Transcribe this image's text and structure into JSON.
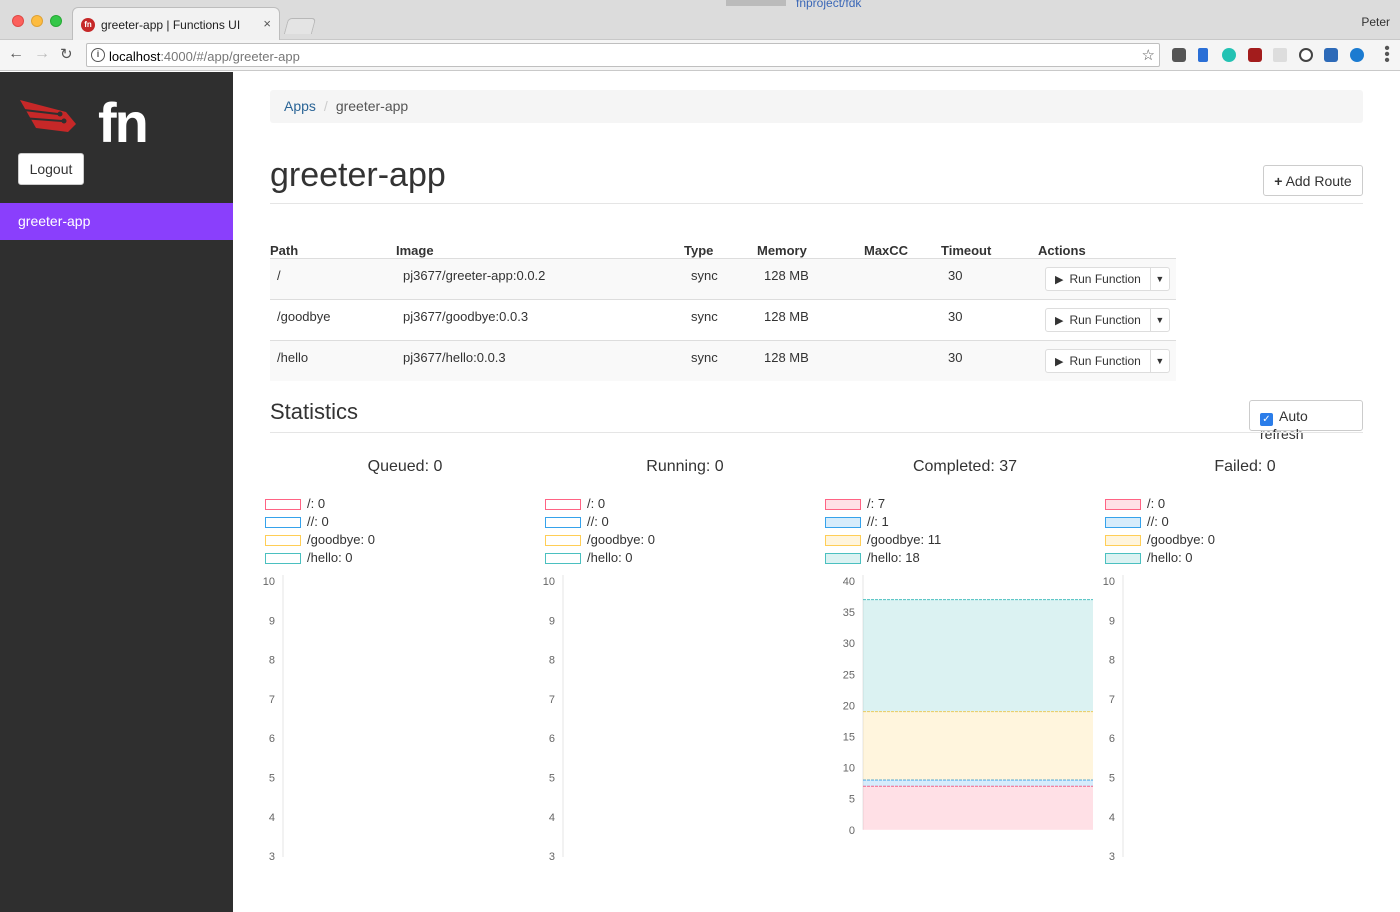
{
  "browser": {
    "tab_title": "greeter-app | Functions UI",
    "tab_close": "×",
    "profile": "Peter",
    "background_link": "fnproject/fdk",
    "url_host": "localhost",
    "url_path": ":4000/#/app/greeter-app",
    "favicon_text": "fn"
  },
  "sidebar": {
    "logo_text": "fn",
    "logout_label": "Logout",
    "items": [
      {
        "label": "greeter-app"
      }
    ]
  },
  "breadcrumb": {
    "root": "Apps",
    "current": "greeter-app"
  },
  "page": {
    "title": "greeter-app",
    "add_route_label": "Add Route"
  },
  "routes": {
    "headers": [
      "Path",
      "Image",
      "Type",
      "Memory",
      "MaxCC",
      "Timeout",
      "Actions"
    ],
    "rows": [
      {
        "path": "/",
        "image": "pj3677/greeter-app:0.0.2",
        "type": "sync",
        "memory": "128 MB",
        "maxcc": "",
        "timeout": "30",
        "action": "Run Function"
      },
      {
        "path": "/goodbye",
        "image": "pj3677/goodbye:0.0.3",
        "type": "sync",
        "memory": "128 MB",
        "maxcc": "",
        "timeout": "30",
        "action": "Run Function"
      },
      {
        "path": "/hello",
        "image": "pj3677/hello:0.0.3",
        "type": "sync",
        "memory": "128 MB",
        "maxcc": "",
        "timeout": "30",
        "action": "Run Function"
      }
    ]
  },
  "statistics": {
    "title": "Statistics",
    "auto_refresh_label": "Auto refresh",
    "auto_refresh_checked": true
  },
  "series_colors": {
    "/": "#ff6384",
    "//": "#36a2eb",
    "/goodbye": "#ffce56",
    "/hello": "#4bc0c0"
  },
  "chart_data": [
    {
      "type": "area",
      "title": "Queued: 0",
      "legend": [
        "/: 0",
        "//: 0",
        "/goodbye: 0",
        "/hello: 0"
      ],
      "series": [
        {
          "name": "/",
          "values": [
            0
          ]
        },
        {
          "name": "//",
          "values": [
            0
          ]
        },
        {
          "name": "/goodbye",
          "values": [
            0
          ]
        },
        {
          "name": "/hello",
          "values": [
            0
          ]
        }
      ],
      "yticks": [
        10,
        9,
        8,
        7,
        6,
        5,
        4,
        3
      ],
      "ylim": [
        3,
        10
      ],
      "stacked": true,
      "filled": false
    },
    {
      "type": "area",
      "title": "Running: 0",
      "legend": [
        "/: 0",
        "//: 0",
        "/goodbye: 0",
        "/hello: 0"
      ],
      "series": [
        {
          "name": "/",
          "values": [
            0
          ]
        },
        {
          "name": "//",
          "values": [
            0
          ]
        },
        {
          "name": "/goodbye",
          "values": [
            0
          ]
        },
        {
          "name": "/hello",
          "values": [
            0
          ]
        }
      ],
      "yticks": [
        10,
        9,
        8,
        7,
        6,
        5,
        4,
        3
      ],
      "ylim": [
        3,
        10
      ],
      "stacked": true,
      "filled": false
    },
    {
      "type": "area",
      "title": "Completed: 37",
      "legend": [
        "/: 7",
        "//: 1",
        "/goodbye: 11",
        "/hello: 18"
      ],
      "series": [
        {
          "name": "/",
          "values": [
            7
          ]
        },
        {
          "name": "//",
          "values": [
            1
          ]
        },
        {
          "name": "/goodbye",
          "values": [
            11
          ]
        },
        {
          "name": "/hello",
          "values": [
            18
          ]
        }
      ],
      "yticks": [
        40,
        35,
        30,
        25,
        20,
        15,
        10,
        5,
        0
      ],
      "ylim": [
        0,
        40
      ],
      "stacked": true,
      "filled": true
    },
    {
      "type": "area",
      "title": "Failed: 0",
      "legend": [
        "/: 0",
        "//: 0",
        "/goodbye: 0",
        "/hello: 0"
      ],
      "series": [
        {
          "name": "/",
          "values": [
            0
          ]
        },
        {
          "name": "//",
          "values": [
            0
          ]
        },
        {
          "name": "/goodbye",
          "values": [
            0
          ]
        },
        {
          "name": "/hello",
          "values": [
            0
          ]
        }
      ],
      "yticks": [
        10,
        9,
        8,
        7,
        6,
        5,
        4,
        3
      ],
      "ylim": [
        3,
        10
      ],
      "stacked": true,
      "filled": true
    }
  ]
}
